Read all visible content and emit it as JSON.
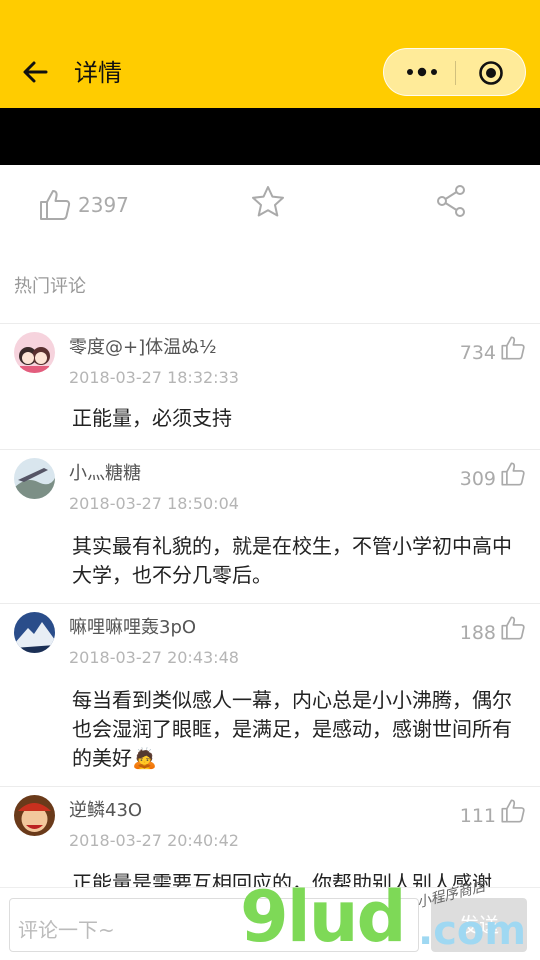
{
  "header": {
    "title": "详情",
    "accent_color": "#FFCC00",
    "back_icon": "back-arrow-icon",
    "more_icon": "more-dots-icon",
    "close_icon": "target-circle-icon"
  },
  "actions": {
    "like_count": "2397",
    "like_icon": "thumbs-up-icon",
    "favorite_icon": "star-icon",
    "share_icon": "share-icon"
  },
  "section": {
    "title": "热门评论"
  },
  "comments": [
    {
      "user": "零度@+]体温ぬ½",
      "time": "2018-03-27 18:32:33",
      "likes": "734",
      "text": "正能量，必须支持"
    },
    {
      "user": "小灬糖糖",
      "time": "2018-03-27 18:50:04",
      "likes": "309",
      "text": "其实最有礼貌的，就是在校生，不管小学初中高中大学，也不分几零后。"
    },
    {
      "user": "嘛哩嘛哩轰3pO",
      "time": "2018-03-27 20:43:48",
      "likes": "188",
      "text": "每当看到类似感人一幕，内心总是小小沸腾，偶尔也会湿润了眼眶，是满足，是感动，感谢世间所有的美好🙇"
    },
    {
      "user": "逆鳞43O",
      "time": "2018-03-27 20:40:42",
      "likes": "111",
      "text": "正能量是需要互相回应的，你帮助别人别人感谢"
    }
  ],
  "composer": {
    "placeholder": "评论一下~",
    "send_label": "发送"
  },
  "watermark": {
    "brand": "9lud",
    "tld": ".com",
    "tagline": "小程序商店"
  }
}
